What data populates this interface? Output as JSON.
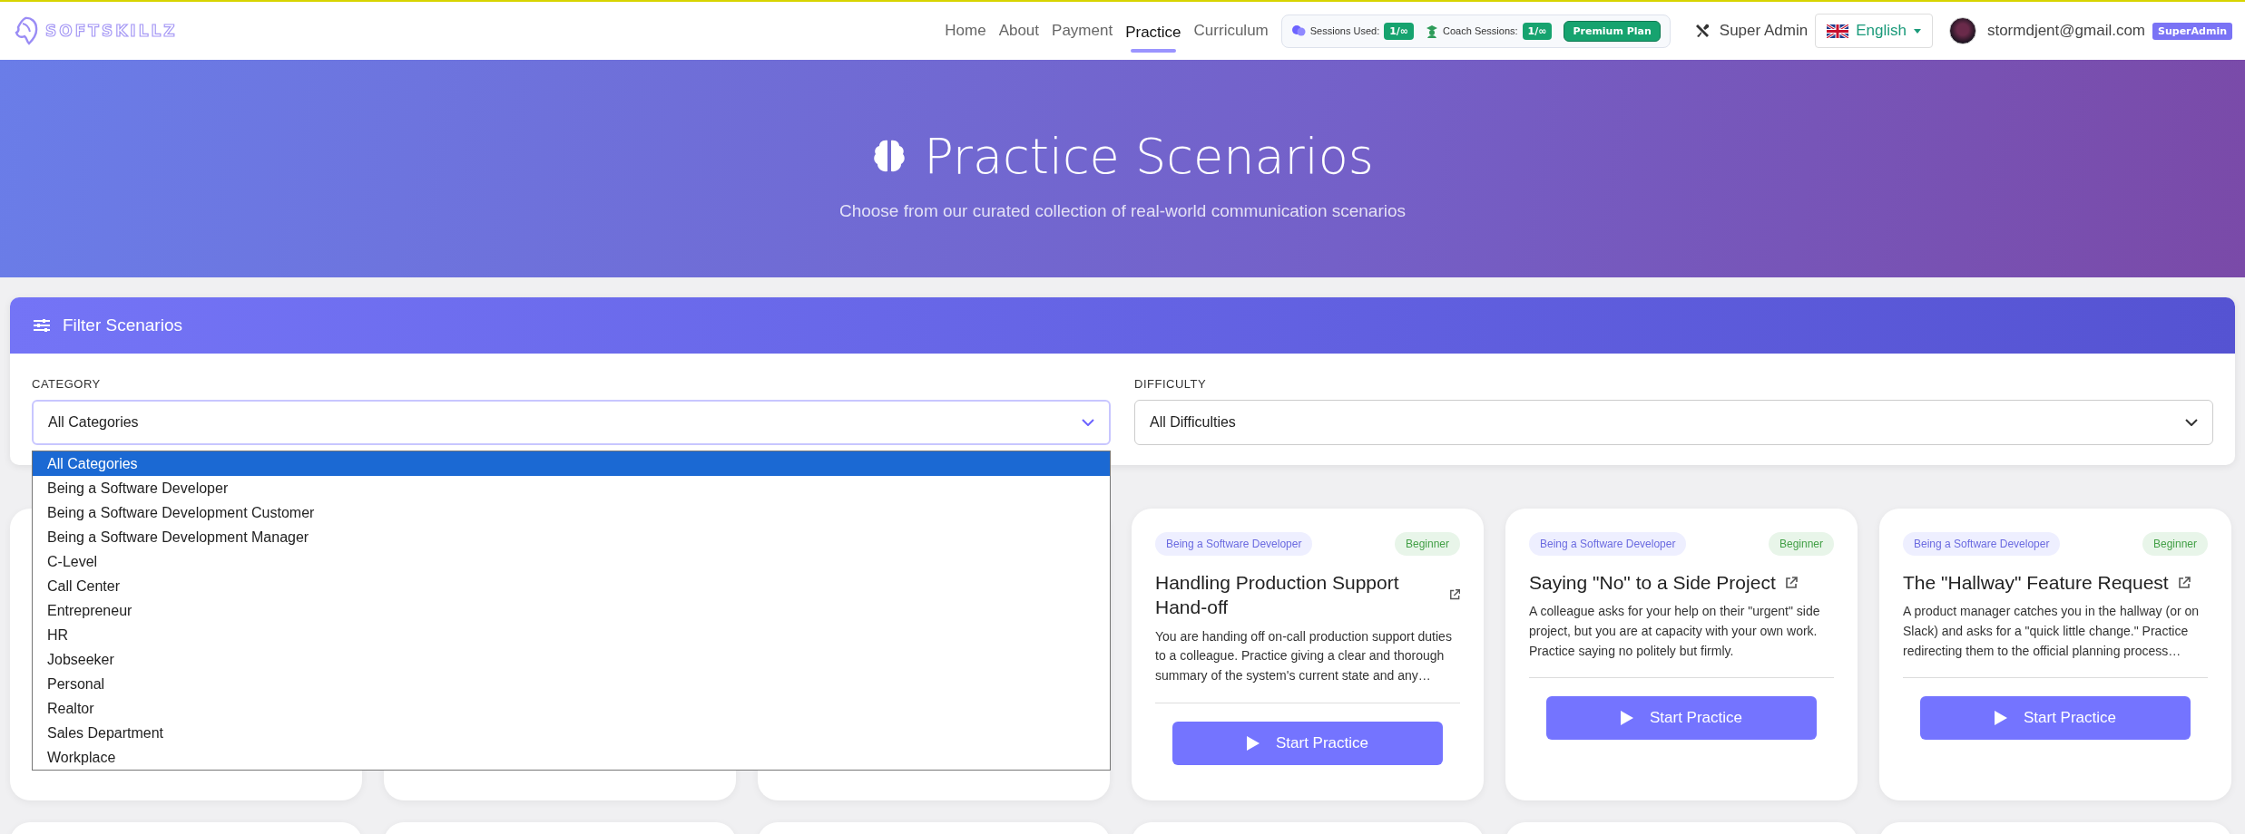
{
  "brand": {
    "name": "SOFTSKILLZ"
  },
  "nav": [
    {
      "label": "Home",
      "selected": false
    },
    {
      "label": "About",
      "selected": false
    },
    {
      "label": "Payment",
      "selected": false
    },
    {
      "label": "Practice",
      "selected": true
    },
    {
      "label": "Curriculum",
      "selected": false
    }
  ],
  "usage": {
    "sessions_label": "Sessions Used:",
    "sessions_value": "1/∞",
    "coach_label": "Coach Sessions:",
    "coach_value": "1/∞",
    "plan": "Premium Plan"
  },
  "admin_link": "Super Admin",
  "language": "English",
  "user": {
    "email": "stormdjent@gmail.com",
    "role": "SuperAdmin"
  },
  "hero": {
    "title": "Practice Scenarios",
    "subtitle": "Choose from our curated collection of real-world communication scenarios"
  },
  "filter": {
    "title": "Filter Scenarios",
    "category": {
      "label": "CATEGORY",
      "value": "All Categories",
      "expanded": true,
      "options": [
        {
          "label": "All Categories",
          "selected": true
        },
        {
          "label": "Being a Software Developer",
          "selected": false
        },
        {
          "label": "Being a Software Development Customer",
          "selected": false
        },
        {
          "label": "Being a Software Development Manager",
          "selected": false
        },
        {
          "label": "C-Level",
          "selected": false
        },
        {
          "label": "Call Center",
          "selected": false
        },
        {
          "label": "Entrepreneur",
          "selected": false
        },
        {
          "label": "HR",
          "selected": false
        },
        {
          "label": "Jobseeker",
          "selected": false
        },
        {
          "label": "Personal",
          "selected": false
        },
        {
          "label": "Realtor",
          "selected": false
        },
        {
          "label": "Sales Department",
          "selected": false
        },
        {
          "label": "Workplace",
          "selected": false
        }
      ]
    },
    "difficulty": {
      "label": "DIFFICULTY",
      "value": "All Difficulties"
    }
  },
  "scenarios": [
    {
      "category": "Being a Software Developer",
      "difficulty": "Beginner",
      "title": "Handling Production Support Hand-off",
      "description": "You are handing off on-call production support duties to a colleague. Practice giving a clear and thorough summary of the system's current state and any…",
      "button": "Start Practice"
    },
    {
      "category": "Being a Software Developer",
      "difficulty": "Beginner",
      "title": "Saying \"No\" to a Side Project",
      "description": "A colleague asks for your help on their \"urgent\" side project, but you are at capacity with your own work. Practice saying no politely but firmly.",
      "button": "Start Practice"
    },
    {
      "category": "Being a Software Developer",
      "difficulty": "Beginner",
      "title": "The \"Hallway\" Feature Request",
      "description": "A product manager catches you in the hallway (or on Slack) and asks for a \"quick little change.\" Practice redirecting them to the official planning process…",
      "button": "Start Practice"
    }
  ]
}
